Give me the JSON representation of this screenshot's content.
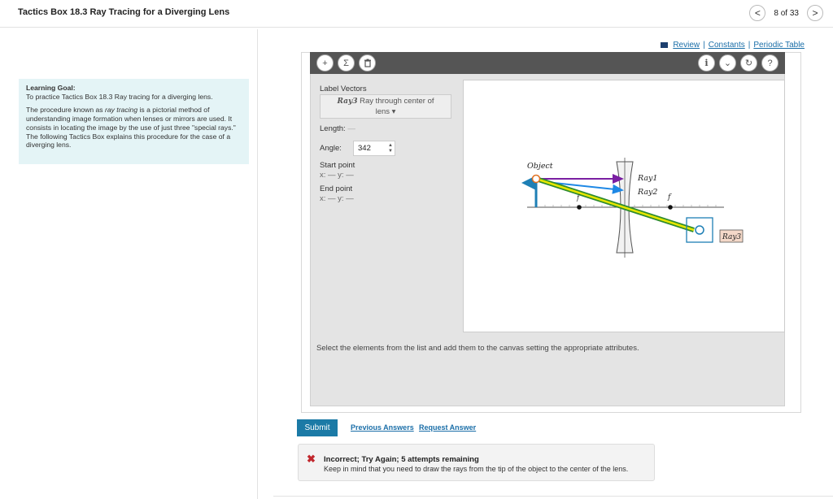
{
  "header": {
    "title": "Tactics Box 18.3 Ray Tracing for a Diverging Lens",
    "prev_glyph": "<",
    "page_status": "8 of 33",
    "next_glyph": ">"
  },
  "learning_goal": {
    "title": "Learning Goal:",
    "intro": "To practice Tactics Box 18.3 Ray tracing for a diverging lens.",
    "body_pre": "The procedure known as ",
    "body_em": "ray tracing",
    "body_post": " is a pictorial method of understanding image formation when lenses or mirrors are used. It consists in locating the image by the use of just three \"special rays.\" The following Tactics Box explains this procedure for the case of a diverging lens."
  },
  "top_links": {
    "review": "Review",
    "sep1": "|",
    "constants": "Constants",
    "sep2": "|",
    "periodic_table": "Periodic Table"
  },
  "toolbar": {
    "add_glyph": "+",
    "sum_glyph": "Σ",
    "info_glyph": "i",
    "expand_glyph": "⌄",
    "reset_glyph": "↻",
    "help_glyph": "?"
  },
  "panel": {
    "label_vectors": "Label Vectors",
    "vector_name": "Ray3",
    "vector_desc": "Ray through center of",
    "vector_desc2": "lens ▾",
    "length_label": "Length:",
    "length_value": "—",
    "angle_label": "Angle:",
    "angle_value": "342",
    "start_label": "Start point",
    "start_coords": "x: — y: —",
    "end_label": "End point",
    "end_coords": "x: — y: —"
  },
  "canvas": {
    "object_label": "Object",
    "ray1_label": "Ray1",
    "ray2_label": "Ray2",
    "ray3_label": "Ray3",
    "focal_label_left": "f",
    "focal_label_right": "f"
  },
  "instruction": "Select the elements from the list and add them to the canvas setting the appropriate attributes.",
  "actions": {
    "submit": "Submit",
    "previous_answers": "Previous Answers",
    "request_answer": "Request Answer"
  },
  "feedback": {
    "icon": "✖",
    "title": "Incorrect; Try Again; 5 attempts remaining",
    "message": "Keep in mind that you need to draw the rays from the tip of the object to the center of the lens."
  },
  "colors": {
    "ray1": "#7a1fa2",
    "ray2": "#1e88e5",
    "ray3_outer": "#2e8b2e",
    "ray3_inner": "#e6e600",
    "object": "#1e7fb5",
    "accent": "#1b7aa6",
    "error": "#c1272d"
  }
}
